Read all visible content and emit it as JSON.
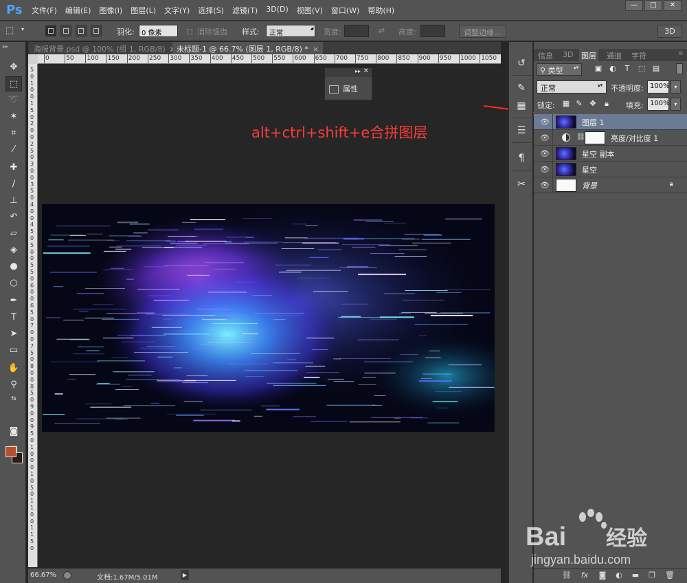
{
  "app": {
    "logo": "Ps"
  },
  "menu": [
    "文件(F)",
    "编辑(E)",
    "图像(I)",
    "图层(L)",
    "文字(Y)",
    "选择(S)",
    "滤镜(T)",
    "3D(D)",
    "视图(V)",
    "窗口(W)",
    "帮助(H)"
  ],
  "window_controls": {
    "minimize": "—",
    "maximize": "□",
    "close": "✕"
  },
  "options": {
    "feather_label": "羽化:",
    "feather_value": "0 像素",
    "antialias_label": "消除锯齿",
    "style_label": "样式:",
    "style_value": "正常",
    "width_label": "宽度:",
    "height_label": "高度:",
    "refine_edge": "调整边缘...",
    "workspace": "3D"
  },
  "tabs": [
    {
      "label": "海报背景.psd @ 100% (组 1, RGB/8)",
      "close": "×"
    },
    {
      "label": "未标题-1 @ 66.7% (图层 1, RGB/8) *",
      "close": "×"
    }
  ],
  "ruler_marks": [
    "0",
    "50",
    "100",
    "150",
    "200",
    "250",
    "300",
    "350",
    "400",
    "450",
    "500",
    "550",
    "600",
    "650",
    "700",
    "750",
    "800",
    "850",
    "900",
    "950",
    "1000",
    "1050"
  ],
  "ruler_left_digits": [
    "5",
    "0",
    "1",
    "0",
    "0",
    "1",
    "5",
    "0",
    "2",
    "0",
    "0",
    "2",
    "5",
    "0",
    "3",
    "0",
    "0",
    "3",
    "5",
    "0",
    "4",
    "0",
    "0",
    "4",
    "5",
    "0",
    "5",
    "0",
    "0",
    "5",
    "5",
    "0",
    "6",
    "0",
    "0",
    "6",
    "5",
    "0",
    "7",
    "0",
    "0",
    "7",
    "5",
    "0",
    "8",
    "0",
    "0",
    "8",
    "5",
    "0",
    "9",
    "0",
    "0",
    "9",
    "5",
    "0",
    "1",
    "0",
    "0",
    "0",
    "1",
    "0",
    "5",
    "0",
    "1",
    "1",
    "0",
    "0",
    "1",
    "1",
    "5",
    "0"
  ],
  "properties_panel": {
    "label": "属性"
  },
  "annotation": "alt+ctrl+shift+e合拼图层",
  "status": {
    "zoom": "66.67%",
    "doc": "文档:1.67M/5.01M"
  },
  "layers_panel": {
    "tabs": [
      "信息",
      "3D",
      "图层",
      "通道",
      "字符"
    ],
    "kind": "类型",
    "blend_mode": "正常",
    "opacity_label": "不透明度:",
    "opacity_value": "100%",
    "lock_label": "锁定:",
    "fill_label": "填充:",
    "fill_value": "100%",
    "layers": [
      {
        "name": "图层 1",
        "selected": true,
        "type": "pixel"
      },
      {
        "name": "亮度/对比度 1",
        "selected": false,
        "type": "adjustment"
      },
      {
        "name": "星空 副本",
        "selected": false,
        "type": "pixel"
      },
      {
        "name": "星空",
        "selected": false,
        "type": "pixel"
      },
      {
        "name": "背景",
        "selected": false,
        "type": "background"
      }
    ]
  },
  "watermark": {
    "brand": "Bai",
    "brand_cn": "经验",
    "url": "jingyan.baidu.com"
  },
  "colors": {
    "foreground": "#b5512f",
    "background": "#2b1a16",
    "accent_annotation": "#ff3b3b",
    "selected_layer": "#6b7b95"
  }
}
